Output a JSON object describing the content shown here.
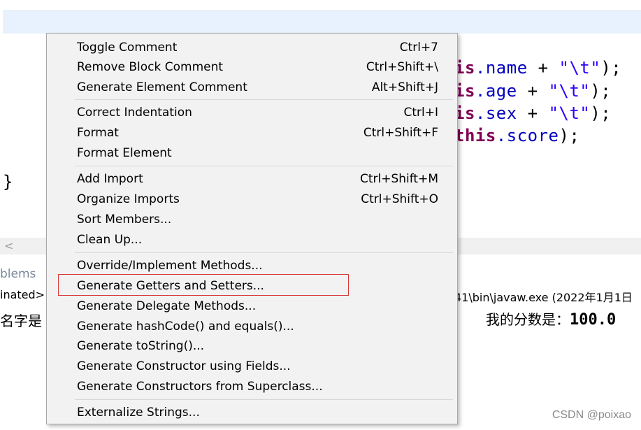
{
  "editor": {
    "lines": [
      {
        "kw": "is",
        "field": ".name",
        "op": " + ",
        "str": "\"\\t\"",
        "end": ");"
      },
      {
        "kw": "is",
        "field": ".age",
        "op": " + ",
        "str": "\"\\t\"",
        "end": ");"
      },
      {
        "kw": "is",
        "field": ".sex",
        "op": " + ",
        "str": "\"\\t\"",
        "end": ");"
      },
      {
        "kw": "this",
        "field": ".score",
        "op": "",
        "str": "",
        "end": ");"
      }
    ],
    "closing_brace": "}"
  },
  "scrollbar": {
    "left_arrow": "<"
  },
  "console": {
    "tab_label": "blems",
    "path_left": "inated>",
    "path_right": "41\\bin\\javaw.exe (2022年1月1日",
    "output_left": "名字是",
    "output_right_label": "我的分数是：",
    "output_right_value": "100.0"
  },
  "context_menu": {
    "groups": [
      [
        {
          "label": "Toggle Comment",
          "accel": "Ctrl+7"
        },
        {
          "label": "Remove Block Comment",
          "accel": "Ctrl+Shift+\\"
        },
        {
          "label": "Generate Element Comment",
          "accel": "Alt+Shift+J"
        }
      ],
      [
        {
          "label": "Correct Indentation",
          "accel": "Ctrl+I"
        },
        {
          "label": "Format",
          "accel": "Ctrl+Shift+F"
        },
        {
          "label": "Format Element",
          "accel": ""
        }
      ],
      [
        {
          "label": "Add Import",
          "accel": "Ctrl+Shift+M"
        },
        {
          "label": "Organize Imports",
          "accel": "Ctrl+Shift+O"
        },
        {
          "label": "Sort Members...",
          "accel": ""
        },
        {
          "label": "Clean Up...",
          "accel": ""
        }
      ],
      [
        {
          "label": "Override/Implement Methods...",
          "accel": ""
        },
        {
          "label": "Generate Getters and Setters...",
          "accel": ""
        },
        {
          "label": "Generate Delegate Methods...",
          "accel": ""
        },
        {
          "label": "Generate hashCode() and equals()...",
          "accel": ""
        },
        {
          "label": "Generate toString()...",
          "accel": ""
        },
        {
          "label": "Generate Constructor using Fields...",
          "accel": ""
        },
        {
          "label": "Generate Constructors from Superclass...",
          "accel": ""
        }
      ],
      [
        {
          "label": "Externalize Strings...",
          "accel": ""
        }
      ]
    ],
    "highlight_color": "#d93838"
  },
  "watermark": "CSDN @poixao"
}
